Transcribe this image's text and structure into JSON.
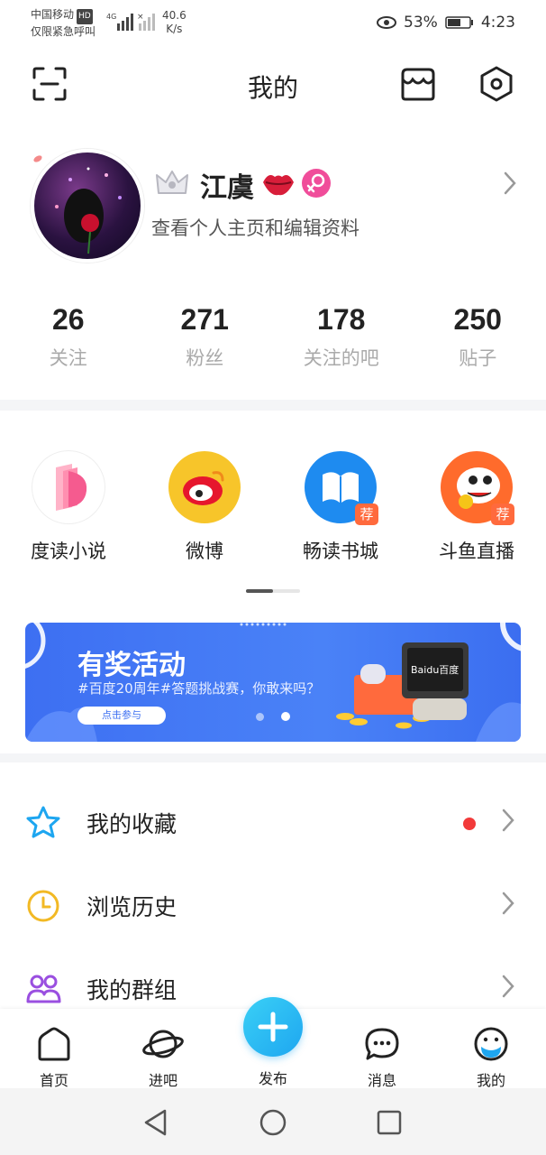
{
  "status_bar": {
    "carrier_line1": "中国移动",
    "carrier_badge": "HD",
    "carrier_line2": "仅限紧急呼叫",
    "net_type": "4G",
    "speed_value": "40.6",
    "speed_unit": "K/s",
    "battery": "53%",
    "time": "4:23"
  },
  "header": {
    "title": "我的",
    "scan_icon": "scan-icon",
    "store_icon": "store-icon",
    "settings_icon": "settings-hexagon-icon"
  },
  "profile": {
    "name": "江虞",
    "subtitle": "查看个人主页和编辑资料",
    "badges": [
      "crown-icon",
      "lips-icon",
      "female-icon"
    ]
  },
  "stats": [
    {
      "value": "26",
      "label": "关注"
    },
    {
      "value": "271",
      "label": "粉丝"
    },
    {
      "value": "178",
      "label": "关注的吧"
    },
    {
      "value": "250",
      "label": "贴子"
    }
  ],
  "apps": [
    {
      "label": "度读小说",
      "icon": "dudu-novel-icon",
      "badge": ""
    },
    {
      "label": "微博",
      "icon": "weibo-icon",
      "badge": ""
    },
    {
      "label": "畅读书城",
      "icon": "book-city-icon",
      "badge": "荐"
    },
    {
      "label": "斗鱼直播",
      "icon": "douyu-icon",
      "badge": "荐"
    }
  ],
  "banner": {
    "title": "有奖活动",
    "subtitle": "#百度20周年#答题挑战赛，你敢来吗？",
    "button": "点击参与",
    "screen_text": "Baidu百度",
    "page_count": 2,
    "active_page": 2
  },
  "menu": [
    {
      "label": "我的收藏",
      "icon": "star-icon",
      "has_dot": true
    },
    {
      "label": "浏览历史",
      "icon": "clock-icon",
      "has_dot": false
    },
    {
      "label": "我的群组",
      "icon": "group-icon",
      "has_dot": false
    }
  ],
  "tabbar": {
    "tabs": [
      {
        "label": "首页",
        "icon": "home-icon"
      },
      {
        "label": "进吧",
        "icon": "planet-icon"
      },
      {
        "label": "发布",
        "icon": "plus-icon"
      },
      {
        "label": "消息",
        "icon": "message-icon"
      },
      {
        "label": "我的",
        "icon": "me-icon"
      }
    ]
  },
  "colors": {
    "accent_blue": "#1ea6f0",
    "banner_blue": "#3d6ff2",
    "red_dot": "#f23a3a",
    "badge_orange": "#ff6a3d"
  }
}
